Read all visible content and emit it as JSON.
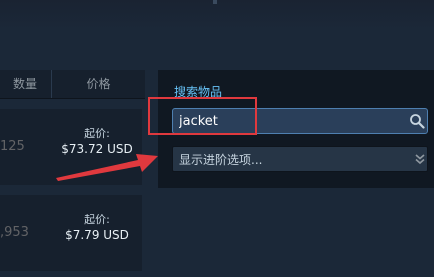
{
  "listing_table": {
    "headers": {
      "quantity": "数量",
      "price": "价格"
    },
    "rows": [
      {
        "quantity": "125",
        "price_label": "起价:",
        "price": "$73.72 USD"
      },
      {
        "quantity": ",953",
        "price_label": "起价:",
        "price": "$7.79 USD"
      }
    ]
  },
  "search": {
    "label": "搜索物品",
    "value": "jacket",
    "icon": "search-icon",
    "advanced_label": "显示进阶选项...",
    "advanced_icon": "chevron-down-icon"
  },
  "annotations": {
    "highlight_color": "#e0393e",
    "arrow_color": "#e0393e"
  },
  "colors": {
    "background": "#1b2838",
    "panel": "#101822",
    "accent": "#67c1f5"
  }
}
